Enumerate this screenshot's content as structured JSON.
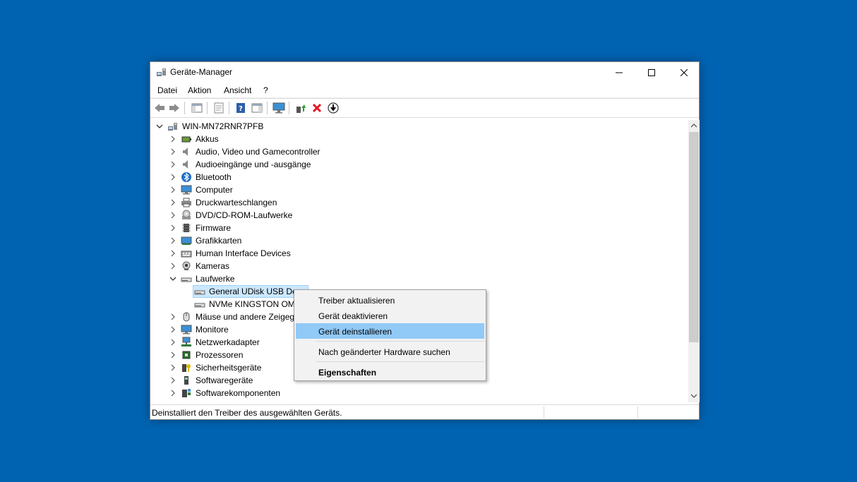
{
  "window": {
    "title": "Geräte-Manager"
  },
  "menu": [
    "Datei",
    "Aktion",
    "Ansicht",
    "?"
  ],
  "tree": {
    "root": "WIN-MN72RNR7PFB",
    "items": [
      {
        "label": "Akkus",
        "icon": "battery-icon"
      },
      {
        "label": "Audio, Video und Gamecontroller",
        "icon": "speaker-icon"
      },
      {
        "label": "Audioeingänge und -ausgänge",
        "icon": "speaker-icon"
      },
      {
        "label": "Bluetooth",
        "icon": "bluetooth-icon"
      },
      {
        "label": "Computer",
        "icon": "computer-icon"
      },
      {
        "label": "Druckwarteschlangen",
        "icon": "printer-icon"
      },
      {
        "label": "DVD/CD-ROM-Laufwerke",
        "icon": "disc-icon"
      },
      {
        "label": "Firmware",
        "icon": "chip-icon"
      },
      {
        "label": "Grafikkarten",
        "icon": "display-adapter-icon"
      },
      {
        "label": "Human Interface Devices",
        "icon": "keyboard-icon"
      },
      {
        "label": "Kameras",
        "icon": "camera-icon"
      },
      {
        "label": "Laufwerke",
        "icon": "drive-icon"
      },
      {
        "label": "General UDisk USB Dev",
        "icon": "drive-icon"
      },
      {
        "label": "NVMe KINGSTON OM",
        "icon": "drive-icon"
      },
      {
        "label": "Mäuse und andere Zeigeg",
        "icon": "mouse-icon"
      },
      {
        "label": "Monitore",
        "icon": "monitor-icon"
      },
      {
        "label": "Netzwerkadapter",
        "icon": "network-icon"
      },
      {
        "label": "Prozessoren",
        "icon": "processor-icon"
      },
      {
        "label": "Sicherheitsgeräte",
        "icon": "security-device-icon"
      },
      {
        "label": "Softwaregeräte",
        "icon": "software-device-icon"
      },
      {
        "label": "Softwarekomponenten",
        "icon": "software-component-icon"
      }
    ]
  },
  "context_menu": {
    "items": [
      "Treiber aktualisieren",
      "Gerät deaktivieren",
      "Gerät deinstallieren",
      "Nach geänderter Hardware suchen",
      "Eigenschaften"
    ],
    "highlighted": "Gerät deinstallieren"
  },
  "status": {
    "text": "Deinstalliert den Treiber des ausgewählten Geräts."
  },
  "colors": {
    "desktop": "#0063B1",
    "highlight": "#91c9f7",
    "selection": "#cce8ff"
  }
}
